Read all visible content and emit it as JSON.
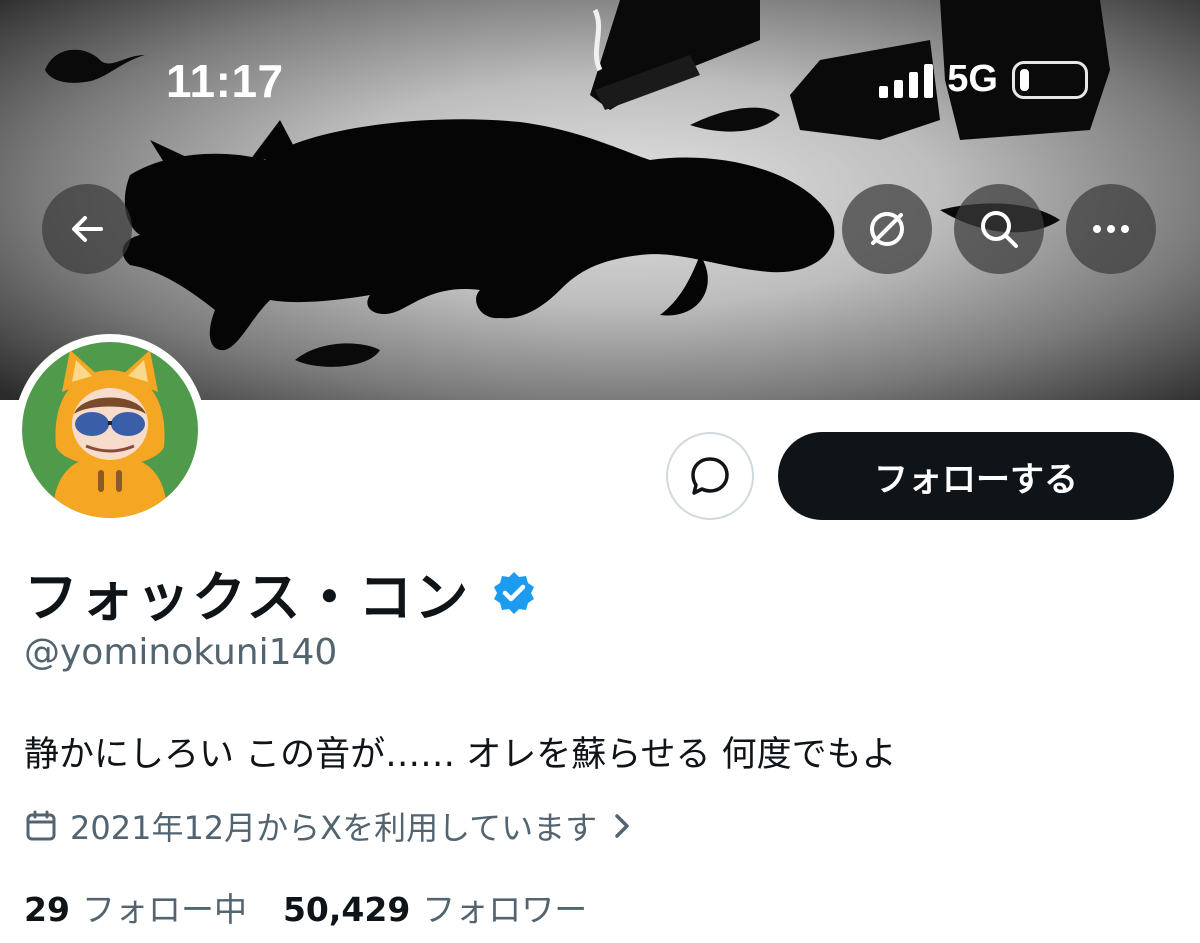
{
  "status_bar": {
    "time": "11:17",
    "network": "5G",
    "signal_bars": 4,
    "battery_level": 0.1
  },
  "banner": {
    "back_icon": "arrow-left-icon",
    "right_actions": [
      "grok-icon",
      "search-icon",
      "more-icon"
    ]
  },
  "profile": {
    "display_name": "フォックス・コン",
    "verified": true,
    "handle": "@yominokuni140",
    "bio": "静かにしろい この音が…… オレを蘇らせる 何度でもよ",
    "joined_text": "2021年12月からXを利用しています"
  },
  "actions": {
    "message_icon": "message-bubble-icon",
    "follow_label": "フォローする"
  },
  "stats": {
    "following_count": "29",
    "following_label": "フォロー中",
    "followers_count": "50,429",
    "followers_label": "フォロワー"
  },
  "colors": {
    "text": "#0f1419",
    "secondary": "#536471",
    "verified": "#1d9bf0",
    "follow_bg": "#0f1419"
  }
}
